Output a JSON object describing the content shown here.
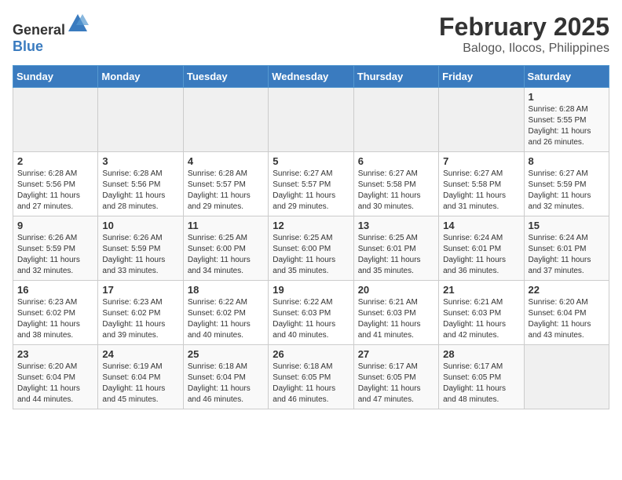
{
  "header": {
    "logo_general": "General",
    "logo_blue": "Blue",
    "month_title": "February 2025",
    "location": "Balogo, Ilocos, Philippines"
  },
  "weekdays": [
    "Sunday",
    "Monday",
    "Tuesday",
    "Wednesday",
    "Thursday",
    "Friday",
    "Saturday"
  ],
  "weeks": [
    [
      {
        "day": "",
        "empty": true
      },
      {
        "day": "",
        "empty": true
      },
      {
        "day": "",
        "empty": true
      },
      {
        "day": "",
        "empty": true
      },
      {
        "day": "",
        "empty": true
      },
      {
        "day": "",
        "empty": true
      },
      {
        "day": "1",
        "sunrise": "6:28 AM",
        "sunset": "5:55 PM",
        "daylight": "11 hours and 26 minutes."
      }
    ],
    [
      {
        "day": "2",
        "sunrise": "6:28 AM",
        "sunset": "5:56 PM",
        "daylight": "11 hours and 27 minutes."
      },
      {
        "day": "3",
        "sunrise": "6:28 AM",
        "sunset": "5:56 PM",
        "daylight": "11 hours and 28 minutes."
      },
      {
        "day": "4",
        "sunrise": "6:28 AM",
        "sunset": "5:57 PM",
        "daylight": "11 hours and 29 minutes."
      },
      {
        "day": "5",
        "sunrise": "6:27 AM",
        "sunset": "5:57 PM",
        "daylight": "11 hours and 29 minutes."
      },
      {
        "day": "6",
        "sunrise": "6:27 AM",
        "sunset": "5:58 PM",
        "daylight": "11 hours and 30 minutes."
      },
      {
        "day": "7",
        "sunrise": "6:27 AM",
        "sunset": "5:58 PM",
        "daylight": "11 hours and 31 minutes."
      },
      {
        "day": "8",
        "sunrise": "6:27 AM",
        "sunset": "5:59 PM",
        "daylight": "11 hours and 32 minutes."
      }
    ],
    [
      {
        "day": "9",
        "sunrise": "6:26 AM",
        "sunset": "5:59 PM",
        "daylight": "11 hours and 32 minutes."
      },
      {
        "day": "10",
        "sunrise": "6:26 AM",
        "sunset": "5:59 PM",
        "daylight": "11 hours and 33 minutes."
      },
      {
        "day": "11",
        "sunrise": "6:25 AM",
        "sunset": "6:00 PM",
        "daylight": "11 hours and 34 minutes."
      },
      {
        "day": "12",
        "sunrise": "6:25 AM",
        "sunset": "6:00 PM",
        "daylight": "11 hours and 35 minutes."
      },
      {
        "day": "13",
        "sunrise": "6:25 AM",
        "sunset": "6:01 PM",
        "daylight": "11 hours and 35 minutes."
      },
      {
        "day": "14",
        "sunrise": "6:24 AM",
        "sunset": "6:01 PM",
        "daylight": "11 hours and 36 minutes."
      },
      {
        "day": "15",
        "sunrise": "6:24 AM",
        "sunset": "6:01 PM",
        "daylight": "11 hours and 37 minutes."
      }
    ],
    [
      {
        "day": "16",
        "sunrise": "6:23 AM",
        "sunset": "6:02 PM",
        "daylight": "11 hours and 38 minutes."
      },
      {
        "day": "17",
        "sunrise": "6:23 AM",
        "sunset": "6:02 PM",
        "daylight": "11 hours and 39 minutes."
      },
      {
        "day": "18",
        "sunrise": "6:22 AM",
        "sunset": "6:02 PM",
        "daylight": "11 hours and 40 minutes."
      },
      {
        "day": "19",
        "sunrise": "6:22 AM",
        "sunset": "6:03 PM",
        "daylight": "11 hours and 40 minutes."
      },
      {
        "day": "20",
        "sunrise": "6:21 AM",
        "sunset": "6:03 PM",
        "daylight": "11 hours and 41 minutes."
      },
      {
        "day": "21",
        "sunrise": "6:21 AM",
        "sunset": "6:03 PM",
        "daylight": "11 hours and 42 minutes."
      },
      {
        "day": "22",
        "sunrise": "6:20 AM",
        "sunset": "6:04 PM",
        "daylight": "11 hours and 43 minutes."
      }
    ],
    [
      {
        "day": "23",
        "sunrise": "6:20 AM",
        "sunset": "6:04 PM",
        "daylight": "11 hours and 44 minutes."
      },
      {
        "day": "24",
        "sunrise": "6:19 AM",
        "sunset": "6:04 PM",
        "daylight": "11 hours and 45 minutes."
      },
      {
        "day": "25",
        "sunrise": "6:18 AM",
        "sunset": "6:04 PM",
        "daylight": "11 hours and 46 minutes."
      },
      {
        "day": "26",
        "sunrise": "6:18 AM",
        "sunset": "6:05 PM",
        "daylight": "11 hours and 46 minutes."
      },
      {
        "day": "27",
        "sunrise": "6:17 AM",
        "sunset": "6:05 PM",
        "daylight": "11 hours and 47 minutes."
      },
      {
        "day": "28",
        "sunrise": "6:17 AM",
        "sunset": "6:05 PM",
        "daylight": "11 hours and 48 minutes."
      },
      {
        "day": "",
        "empty": true
      }
    ]
  ]
}
